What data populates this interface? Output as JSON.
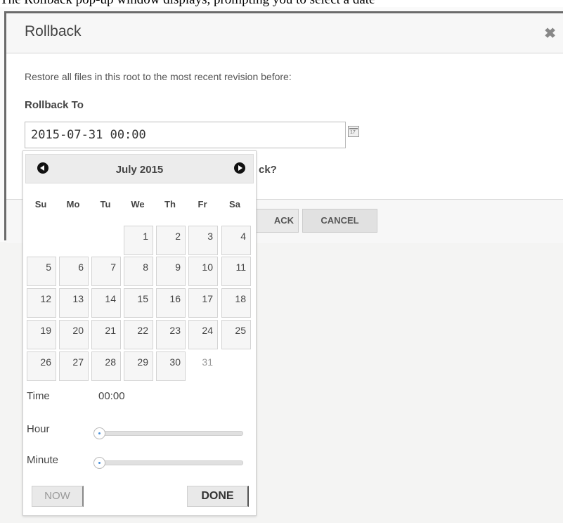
{
  "top_caption": "The Rollback pop-up window displays, prompting you to select a date",
  "dialog": {
    "title": "Rollback",
    "close_glyph": "✖",
    "restore_text": "Restore all files in this root to the most recent revision before:",
    "rollback_to_label": "Rollback To",
    "date_value": "2015-07-31 00:00",
    "confirm_text_visible": "ck?",
    "rollback_button": "ACK",
    "cancel_button": "CANCEL"
  },
  "datepicker": {
    "month_title": "July 2015",
    "weekdays": [
      "Su",
      "Mo",
      "Tu",
      "We",
      "Th",
      "Fr",
      "Sa"
    ],
    "days": [
      "1",
      "2",
      "3",
      "4",
      "5",
      "6",
      "7",
      "8",
      "9",
      "10",
      "11",
      "12",
      "13",
      "14",
      "15",
      "16",
      "17",
      "18",
      "19",
      "20",
      "21",
      "22",
      "23",
      "24",
      "25",
      "26",
      "27",
      "28",
      "29",
      "30",
      "31"
    ],
    "current_day": "31",
    "time_label": "Time",
    "time_value": "00:00",
    "hour_label": "Hour",
    "minute_label": "Minute",
    "hour_value": 0,
    "minute_value": 0,
    "now_button": "NOW",
    "done_button": "DONE"
  },
  "icons": {
    "calendar_button": "calendar-icon",
    "prev_month": "arrow-left-circle-icon",
    "next_month": "arrow-right-circle-icon",
    "close": "close-icon"
  }
}
